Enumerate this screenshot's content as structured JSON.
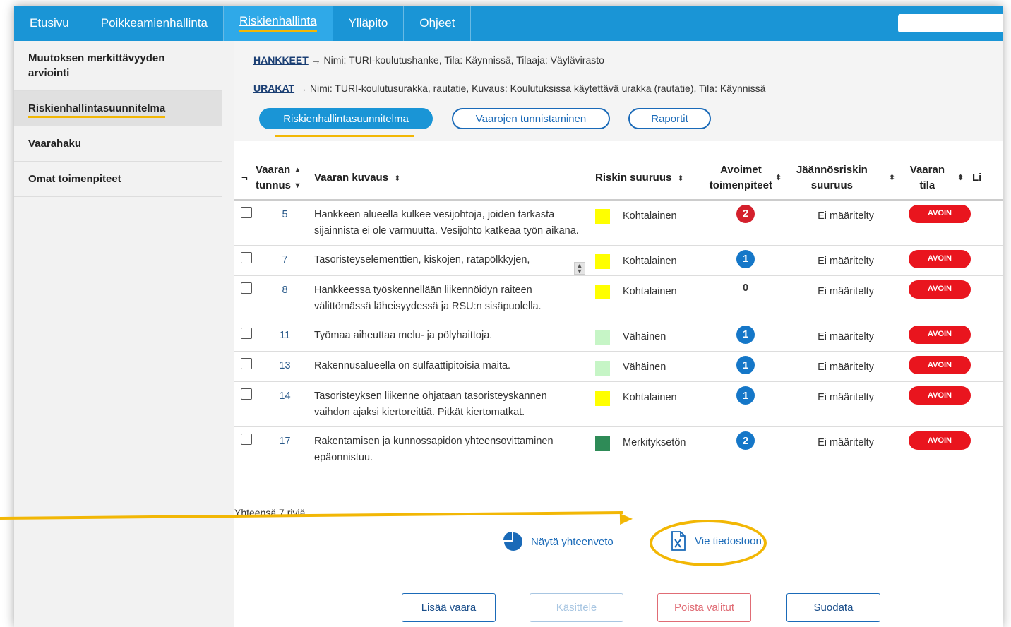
{
  "nav": {
    "items": [
      "Etusivu",
      "Poikkeamienhallinta",
      "Riskienhallinta",
      "Ylläpito",
      "Ohjeet"
    ],
    "active": "Riskienhallinta",
    "search_placeholder": ""
  },
  "sidebar": {
    "items": [
      {
        "label": "Muutoksen merkittävyyden arviointi"
      },
      {
        "label": "Riskienhallintasuunnitelma"
      },
      {
        "label": "Vaarahaku"
      },
      {
        "label": "Omat toimenpiteet"
      }
    ],
    "active": "Riskienhallintasuunnitelma"
  },
  "breadcrumbs": {
    "hankkeet_link": "HANKKEET",
    "hankkeet_text": "→ Nimi: TURI-koulutushanke, Tila: Käynnissä, Tilaaja: Väylävirasto",
    "urakat_link": "URAKAT",
    "urakat_text": "→ Nimi: TURI-koulutusurakka, rautatie, Kuvaus: Koulutuksissa käytettävä urakka (rautatie), Tila: Käynnissä"
  },
  "tabs": [
    "Riskienhallintasuunnitelma",
    "Vaarojen tunnistaminen",
    "Raportit"
  ],
  "table": {
    "headers": {
      "select": "¬",
      "id_line1": "Vaaran",
      "id_line2": "tunnus",
      "desc": "Vaaran kuvaus",
      "risk": "Riskin suuruus",
      "open_line1": "Avoimet",
      "open_line2": "toimenpiteet",
      "res_line1": "Jäännösriskin",
      "res_line2": "suuruus",
      "state_line1": "Vaaran",
      "state_line2": "tila",
      "more": "Li"
    },
    "rows": [
      {
        "id": "5",
        "desc": "Hankkeen alueella kulkee vesijohtoja, joiden tarkasta sijainnista ei ole varmuutta. Vesijohto katkeaa työn aikana.",
        "risk": "Kohtalainen",
        "risk_color": "#ffff00",
        "open": "2",
        "open_style": "red",
        "residual": "Ei määritelty",
        "status": "AVOIN"
      },
      {
        "id": "7",
        "desc": "Tasoristeyselementtien, kiskojen, ratapölkkyjen,",
        "risk": "Kohtalainen",
        "risk_color": "#ffff00",
        "open": "1",
        "open_style": "blue",
        "residual": "Ei määritelty",
        "status": "AVOIN"
      },
      {
        "id": "8",
        "desc": "Hankkeessa työskennellään liikennöidyn raiteen välittömässä läheisyydessä ja RSU:n sisäpuolella.",
        "risk": "Kohtalainen",
        "risk_color": "#ffff00",
        "open": "0",
        "open_style": "none",
        "residual": "Ei määritelty",
        "status": "AVOIN"
      },
      {
        "id": "11",
        "desc": "Työmaa aiheuttaa melu- ja pölyhaittoja.",
        "risk": "Vähäinen",
        "risk_color": "#c6f5c6",
        "open": "1",
        "open_style": "blue",
        "residual": "Ei määritelty",
        "status": "AVOIN"
      },
      {
        "id": "13",
        "desc": "Rakennusalueella on sulfaattipitoisia maita.",
        "risk": "Vähäinen",
        "risk_color": "#c6f5c6",
        "open": "1",
        "open_style": "blue",
        "residual": "Ei määritelty",
        "status": "AVOIN"
      },
      {
        "id": "14",
        "desc": "Tasoristeyksen liikenne ohjataan tasoristeyskannen vaihdon ajaksi kiertoreittiä. Pitkät kiertomatkat.",
        "risk": "Kohtalainen",
        "risk_color": "#ffff00",
        "open": "1",
        "open_style": "blue",
        "residual": "Ei määritelty",
        "status": "AVOIN"
      },
      {
        "id": "17",
        "desc": "Rakentamisen ja kunnossapidon yhteensovittaminen epäonnistuu.",
        "risk": "Merkityksetön",
        "risk_color": "#2e8b57",
        "open": "2",
        "open_style": "blue",
        "residual": "Ei määritelty",
        "status": "AVOIN"
      }
    ]
  },
  "footer": {
    "row_count": "Yhteensä 7 riviä.",
    "summary_link": "Näytä yhteenveto",
    "export_link": "Vie tiedostoon",
    "buttons": {
      "add": "Lisää vaara",
      "handle": "Käsittele",
      "delete": "Poista valitut",
      "filter": "Suodata"
    }
  },
  "icons": {
    "summary": "pie-chart-icon",
    "export": "excel-file-icon",
    "sort": "sort-icon"
  },
  "colors": {
    "nav": "#1a95d6",
    "accent": "#f2b705",
    "status_open": "#e9151e"
  }
}
